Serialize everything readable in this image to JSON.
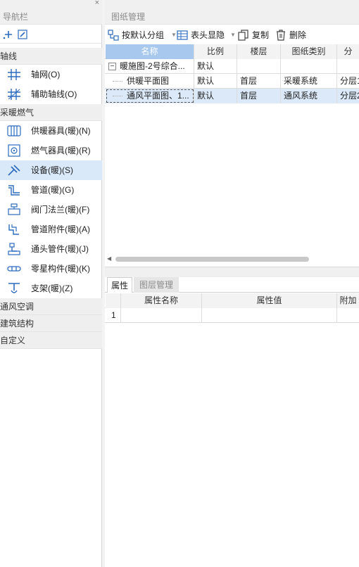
{
  "nav": {
    "title": "导航栏",
    "close_glyph": "×",
    "tools": [
      "add-point-icon",
      "edit-icon"
    ],
    "sections": [
      {
        "label": "轴线",
        "items": [
          {
            "label": "轴网(O)",
            "icon": "grid-axis-icon"
          },
          {
            "label": "辅助轴线(O)",
            "icon": "auxiliary-axis-icon"
          }
        ]
      },
      {
        "label": "采暖燃气",
        "items": [
          {
            "label": "供暖器具(暖)(N)",
            "icon": "radiator-icon"
          },
          {
            "label": "燃气器具(暖)(R)",
            "icon": "gas-appliance-icon"
          },
          {
            "label": "设备(暖)(S)",
            "icon": "equipment-icon",
            "selected": true
          },
          {
            "label": "管道(暖)(G)",
            "icon": "pipe-icon"
          },
          {
            "label": "阀门法兰(暖)(F)",
            "icon": "valve-flange-icon"
          },
          {
            "label": "管道附件(暖)(A)",
            "icon": "pipe-accessory-icon"
          },
          {
            "label": "通头管件(暖)(J)",
            "icon": "pipe-fitting-icon"
          },
          {
            "label": "零星构件(暖)(K)",
            "icon": "misc-component-icon"
          },
          {
            "label": "支架(暖)(Z)",
            "icon": "bracket-icon"
          }
        ]
      },
      {
        "label": "通风空调",
        "items": []
      },
      {
        "label": "建筑结构",
        "items": []
      },
      {
        "label": "自定义",
        "items": []
      }
    ]
  },
  "drawings": {
    "title": "图纸管理",
    "toolbar": {
      "group_label": "按默认分组",
      "header_label": "表头显隐",
      "copy_label": "复制",
      "delete_label": "删除"
    },
    "columns": [
      "名称",
      "比例",
      "楼层",
      "图纸类别",
      "分"
    ],
    "rows": [
      {
        "cells": [
          "暖施图-2号综合...",
          "默认",
          "",
          "",
          ""
        ],
        "toggle": "−",
        "level": 0
      },
      {
        "cells": [
          "供暖平面图",
          "默认",
          "首层",
          "采暖系统",
          "分层1"
        ],
        "level": 1
      },
      {
        "cells": [
          "通风平面图、1...",
          "默认",
          "首层",
          "通风系统",
          "分层2"
        ],
        "level": 1,
        "selected": true
      }
    ],
    "scroll_left_glyph": "◀"
  },
  "properties": {
    "tabs": [
      {
        "label": "属性",
        "active": true
      },
      {
        "label": "图层管理",
        "active": false
      }
    ],
    "columns": [
      "",
      "属性名称",
      "属性值",
      "附加"
    ],
    "rows": [
      [
        "1",
        "",
        "",
        ""
      ]
    ]
  },
  "colors": {
    "selected_bg": "#d9e9f9",
    "active_header": "#a8c8ee",
    "icon_blue": "#2b6bbf"
  }
}
